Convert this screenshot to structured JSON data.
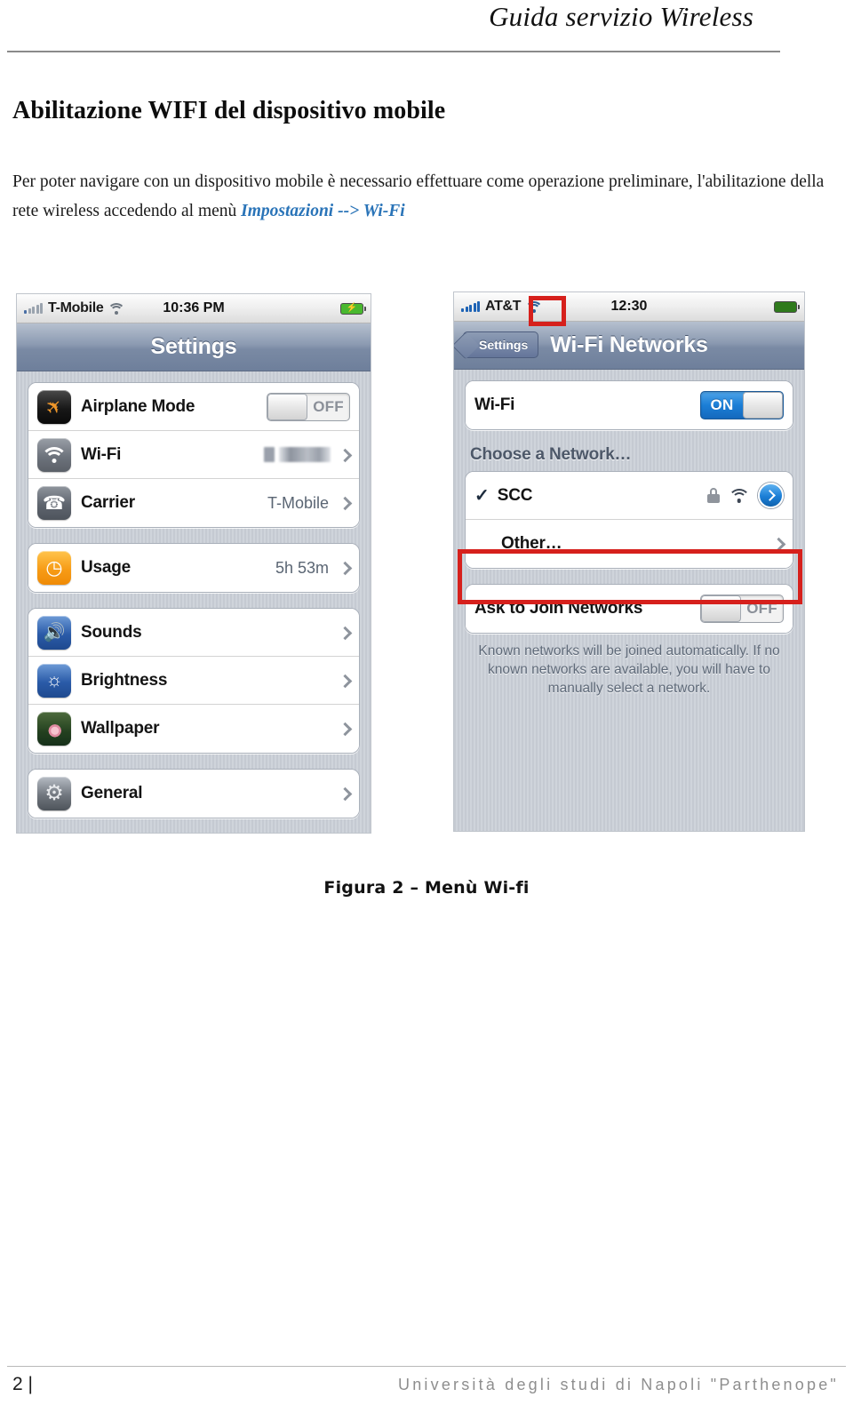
{
  "header": {
    "title": "Guida servizio Wireless"
  },
  "section": {
    "title": "Abilitazione WIFI del dispositivo mobile"
  },
  "paragraph": {
    "part1": "Per poter navigare con un dispositivo mobile è necessario effettuare come operazione preliminare, l'abilitazione della rete wireless accedendo al menù ",
    "link": "Impostazioni --> Wi-Fi"
  },
  "figure": {
    "caption": "Figura 2 – Menù Wi-fi"
  },
  "footer": {
    "page_number": "2 |",
    "university": "Università degli studi di Napoli \"Parthenope\""
  },
  "colors": {
    "link_blue": "#2a74b8",
    "annotation_red": "#d6201c",
    "toggle_on_blue": "#1b7ed6",
    "navbar_blue": "#7a8aa4"
  },
  "screenshot_left": {
    "statusbar": {
      "carrier": "T-Mobile",
      "time": "10:36 PM",
      "signal_icon": "signal-bars-icon",
      "wifi_icon": "wifi-icon",
      "battery_icon": "battery-charging-icon"
    },
    "navbar": {
      "title": "Settings"
    },
    "groups": [
      {
        "rows": [
          {
            "icon": "airplane-icon",
            "label": "Airplane Mode",
            "control": "toggle",
            "toggle_state": "OFF"
          },
          {
            "icon": "wifi-icon",
            "label": "Wi-Fi",
            "control": "redacted",
            "value": "",
            "chevron": true
          },
          {
            "icon": "phone-icon",
            "label": "Carrier",
            "control": "value",
            "value": "T-Mobile",
            "chevron": true
          }
        ]
      },
      {
        "rows": [
          {
            "icon": "clock-icon",
            "label": "Usage",
            "control": "value",
            "value": "5h 53m",
            "chevron": true
          }
        ]
      },
      {
        "rows": [
          {
            "icon": "speaker-icon",
            "label": "Sounds",
            "control": "none",
            "value": "",
            "chevron": true
          },
          {
            "icon": "sun-icon",
            "label": "Brightness",
            "control": "none",
            "value": "",
            "chevron": true
          },
          {
            "icon": "flower-icon",
            "label": "Wallpaper",
            "control": "none",
            "value": "",
            "chevron": true
          }
        ]
      },
      {
        "rows": [
          {
            "icon": "gear-icon",
            "label": "General",
            "control": "none",
            "value": "",
            "chevron": true
          }
        ]
      }
    ]
  },
  "screenshot_right": {
    "statusbar": {
      "carrier": "AT&T",
      "time": "12:30",
      "signal_icon": "signal-bars-icon",
      "wifi_icon": "wifi-icon",
      "battery_icon": "battery-icon"
    },
    "navbar": {
      "back_label": "Settings",
      "title": "Wi-Fi Networks"
    },
    "wifi_row": {
      "label": "Wi-Fi",
      "toggle_state": "ON"
    },
    "choose_network_label": "Choose a Network…",
    "networks": [
      {
        "name": "SCC",
        "connected": true,
        "secured": true,
        "highlighted": true
      },
      {
        "name": "Other…",
        "connected": false,
        "secured": false,
        "highlighted": false
      }
    ],
    "ask_to_join": {
      "label": "Ask to Join Networks",
      "toggle_state": "OFF"
    },
    "footnote": "Known networks will be joined automatically. If no known networks are available, you will have to manually select a network."
  }
}
